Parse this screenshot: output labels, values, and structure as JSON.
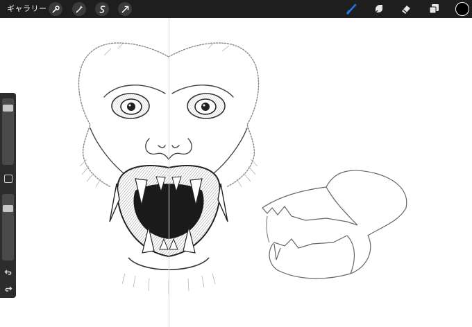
{
  "toolbar": {
    "gallery_label": "ギャラリー",
    "left_tools": [
      "wrench-icon",
      "magic-wand-icon",
      "selection-icon",
      "transform-arrow-icon"
    ],
    "right_tools": [
      "brush-icon",
      "smudge-icon",
      "eraser-icon",
      "layers-icon"
    ],
    "active_tool": "brush",
    "active_color": "#1f7ae0",
    "current_color": "#000000"
  },
  "sidebar": {
    "brush_size_level": 0.05,
    "opacity_level": 0.1,
    "buttons": [
      "modify-button",
      "undo-icon",
      "redo-icon"
    ]
  },
  "canvas": {
    "drawing_guide": "vertical-symmetry"
  }
}
